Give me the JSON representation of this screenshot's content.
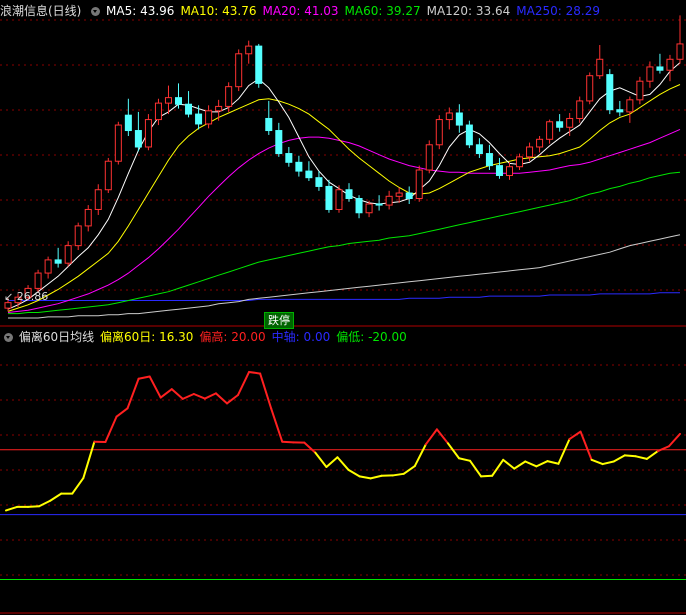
{
  "colors": {
    "bg": "#000000",
    "up": "#ff3232",
    "down": "#54ffff",
    "ma5": "#ffffff",
    "ma10": "#ffff00",
    "ma20": "#ff00ff",
    "ma60": "#00e600",
    "ma120": "#cccccc",
    "ma250": "#2a2aff",
    "grid": "#8a0000"
  },
  "main_panel": {
    "title": "浪潮信息(日线)",
    "indicators": [
      {
        "label": "MA5: 43.96",
        "color": "#ffffff"
      },
      {
        "label": "MA10: 43.76",
        "color": "#ffff00"
      },
      {
        "label": "MA20: 41.03",
        "color": "#ff00ff"
      },
      {
        "label": "MA60: 39.27",
        "color": "#00e600"
      },
      {
        "label": "MA120: 33.64",
        "color": "#cccccc"
      },
      {
        "label": "MA250: 28.29",
        "color": "#2a2aff"
      }
    ],
    "low_label": "26.86",
    "event_tag": "跌停"
  },
  "sub_panel": {
    "title": "偏离60日均线",
    "indicators": [
      {
        "label": "偏离60日: 16.30",
        "color": "#ffff00"
      },
      {
        "label": "偏高: 20.00",
        "color": "#ff2020"
      },
      {
        "label": "中轴: 0.00",
        "color": "#2a2aff"
      },
      {
        "label": "偏低: -20.00",
        "color": "#00e600"
      }
    ]
  },
  "chart_data": [
    {
      "type": "candlestick",
      "title": "浪潮信息(日线)",
      "ylim": [
        26,
        53
      ],
      "candles": [
        [
          26.9,
          27.8,
          26.6,
          27.4
        ],
        [
          27.4,
          28.2,
          27.0,
          27.9
        ],
        [
          27.9,
          29.0,
          27.6,
          28.7
        ],
        [
          28.7,
          30.4,
          28.4,
          30.1
        ],
        [
          30.1,
          31.6,
          29.6,
          31.3
        ],
        [
          31.3,
          32.4,
          30.6,
          31.0
        ],
        [
          31.0,
          33.0,
          30.7,
          32.6
        ],
        [
          32.6,
          34.7,
          32.2,
          34.4
        ],
        [
          34.4,
          36.3,
          33.9,
          35.9
        ],
        [
          35.9,
          38.2,
          35.4,
          37.7
        ],
        [
          37.7,
          40.6,
          37.4,
          40.3
        ],
        [
          40.3,
          43.9,
          40.0,
          43.6
        ],
        [
          44.5,
          46.0,
          42.6,
          43.1
        ],
        [
          43.1,
          44.8,
          41.2,
          41.6
        ],
        [
          41.6,
          44.6,
          41.3,
          44.1
        ],
        [
          44.1,
          46.0,
          43.6,
          45.6
        ],
        [
          45.6,
          47.2,
          44.6,
          46.1
        ],
        [
          46.1,
          47.4,
          45.1,
          45.5
        ],
        [
          45.5,
          46.7,
          44.3,
          44.6
        ],
        [
          44.6,
          45.4,
          43.2,
          43.7
        ],
        [
          43.7,
          45.4,
          43.3,
          44.9
        ],
        [
          44.9,
          45.9,
          44.0,
          45.3
        ],
        [
          45.3,
          47.5,
          44.8,
          47.1
        ],
        [
          47.1,
          50.5,
          46.7,
          50.1
        ],
        [
          50.1,
          51.3,
          49.2,
          50.8
        ],
        [
          50.8,
          51.0,
          47.0,
          47.4
        ],
        [
          44.2,
          45.8,
          42.7,
          43.1
        ],
        [
          43.1,
          43.8,
          40.7,
          41.0
        ],
        [
          41.0,
          41.6,
          39.8,
          40.2
        ],
        [
          40.2,
          40.8,
          38.9,
          39.4
        ],
        [
          39.4,
          40.3,
          38.5,
          38.8
        ],
        [
          38.8,
          39.4,
          37.6,
          38.0
        ],
        [
          38.0,
          38.6,
          35.6,
          35.9
        ],
        [
          35.9,
          38.1,
          35.6,
          37.7
        ],
        [
          37.7,
          38.3,
          36.6,
          36.9
        ],
        [
          36.9,
          37.2,
          35.1,
          35.6
        ],
        [
          35.6,
          36.7,
          35.2,
          36.4
        ],
        [
          36.4,
          37.2,
          35.8,
          36.3
        ],
        [
          36.3,
          37.6,
          35.9,
          37.1
        ],
        [
          37.1,
          37.9,
          36.5,
          37.4
        ],
        [
          37.4,
          38.0,
          36.4,
          36.9
        ],
        [
          36.9,
          39.9,
          36.6,
          39.5
        ],
        [
          39.5,
          42.2,
          39.2,
          41.8
        ],
        [
          41.8,
          44.5,
          41.4,
          44.1
        ],
        [
          44.1,
          45.2,
          43.2,
          44.7
        ],
        [
          44.7,
          45.5,
          42.9,
          43.6
        ],
        [
          43.6,
          44.0,
          41.5,
          41.8
        ],
        [
          41.8,
          42.4,
          40.6,
          41.0
        ],
        [
          41.0,
          41.8,
          39.5,
          39.9
        ],
        [
          39.9,
          40.6,
          38.7,
          39.0
        ],
        [
          39.0,
          40.2,
          38.6,
          39.8
        ],
        [
          39.8,
          41.0,
          39.5,
          40.7
        ],
        [
          40.7,
          42.0,
          40.3,
          41.6
        ],
        [
          41.6,
          42.6,
          41.1,
          42.3
        ],
        [
          42.3,
          44.1,
          41.9,
          43.9
        ],
        [
          43.9,
          44.6,
          43.0,
          43.4
        ],
        [
          43.4,
          44.7,
          42.6,
          44.2
        ],
        [
          44.2,
          46.2,
          43.8,
          45.8
        ],
        [
          45.8,
          48.4,
          45.5,
          48.1
        ],
        [
          48.1,
          50.9,
          47.8,
          49.6
        ],
        [
          48.2,
          48.7,
          44.6,
          45.0
        ],
        [
          45.0,
          45.8,
          44.4,
          44.8
        ],
        [
          44.8,
          46.2,
          43.8,
          45.9
        ],
        [
          45.9,
          48.0,
          45.5,
          47.6
        ],
        [
          47.6,
          49.4,
          47.0,
          48.9
        ],
        [
          48.9,
          50.1,
          48.3,
          48.6
        ],
        [
          48.6,
          50.0,
          47.6,
          49.6
        ],
        [
          49.6,
          53.6,
          49.2,
          51.0
        ]
      ],
      "ma5": [
        26.8,
        27.2,
        27.7,
        28.4,
        29.1,
        29.8,
        30.7,
        31.6,
        32.4,
        33.6,
        35.0,
        37.0,
        39.2,
        41.3,
        43.0,
        44.3,
        44.8,
        45.5,
        45.4,
        45.1,
        44.8,
        44.8,
        45.2,
        46.0,
        47.2,
        47.8,
        47.0,
        45.7,
        44.3,
        42.5,
        40.7,
        39.4,
        38.4,
        37.8,
        37.2,
        36.8,
        36.5,
        36.4,
        36.5,
        36.6,
        36.9,
        37.7,
        38.5,
        39.9,
        41.6,
        42.7,
        43.2,
        42.8,
        42.0,
        41.0,
        40.1,
        40.0,
        40.2,
        40.9,
        41.7,
        42.4,
        43.0,
        43.6,
        44.8,
        46.0,
        46.7,
        47.0,
        46.6,
        46.2,
        46.4,
        47.3,
        48.5,
        49.3
      ],
      "ma10": [
        26.6,
        26.9,
        27.2,
        27.6,
        28.1,
        28.6,
        29.2,
        29.8,
        30.5,
        31.2,
        31.9,
        33.0,
        34.4,
        35.9,
        37.4,
        38.9,
        40.4,
        41.7,
        42.6,
        43.3,
        43.8,
        44.3,
        44.7,
        45.1,
        45.5,
        45.9,
        46.0,
        45.8,
        45.5,
        45.1,
        44.6,
        43.9,
        43.2,
        42.3,
        41.4,
        40.6,
        39.9,
        39.2,
        38.5,
        37.9,
        37.4,
        37.3,
        37.4,
        37.8,
        38.3,
        38.8,
        39.3,
        39.6,
        39.9,
        40.1,
        40.3,
        40.5,
        40.6,
        40.7,
        40.8,
        41.0,
        41.3,
        41.6,
        42.3,
        43.1,
        43.8,
        44.3,
        44.6,
        45.2,
        45.8,
        46.4,
        46.9,
        47.3
      ],
      "ma20": [
        26.5,
        26.6,
        26.7,
        26.9,
        27.1,
        27.3,
        27.6,
        27.9,
        28.2,
        28.6,
        29.0,
        29.5,
        30.1,
        30.8,
        31.5,
        32.3,
        33.2,
        34.1,
        35.1,
        36.1,
        37.1,
        38.0,
        38.9,
        39.7,
        40.4,
        41.0,
        41.5,
        41.9,
        42.2,
        42.4,
        42.5,
        42.5,
        42.4,
        42.2,
        42.0,
        41.7,
        41.3,
        40.9,
        40.5,
        40.2,
        39.9,
        39.7,
        39.5,
        39.4,
        39.3,
        39.3,
        39.2,
        39.2,
        39.2,
        39.2,
        39.2,
        39.2,
        39.3,
        39.4,
        39.5,
        39.7,
        39.9,
        40.0,
        40.2,
        40.5,
        40.8,
        41.1,
        41.4,
        41.7,
        42.0,
        42.4,
        42.8,
        43.2
      ],
      "ma60": [
        26.4,
        26.4,
        26.5,
        26.5,
        26.6,
        26.7,
        26.8,
        26.9,
        27.0,
        27.1,
        27.2,
        27.4,
        27.6,
        27.8,
        28.0,
        28.2,
        28.4,
        28.7,
        29.0,
        29.3,
        29.6,
        29.9,
        30.2,
        30.5,
        30.8,
        31.1,
        31.3,
        31.5,
        31.7,
        31.9,
        32.1,
        32.3,
        32.5,
        32.6,
        32.8,
        32.9,
        33.0,
        33.1,
        33.3,
        33.4,
        33.5,
        33.7,
        33.9,
        34.1,
        34.3,
        34.5,
        34.7,
        34.9,
        35.1,
        35.3,
        35.5,
        35.7,
        35.9,
        36.1,
        36.3,
        36.5,
        36.7,
        37.0,
        37.3,
        37.5,
        37.8,
        38.0,
        38.3,
        38.5,
        38.8,
        39.0,
        39.2,
        39.3
      ],
      "ma120": [
        26.0,
        26.0,
        26.0,
        26.0,
        26.1,
        26.1,
        26.1,
        26.2,
        26.2,
        26.2,
        26.3,
        26.3,
        26.4,
        26.4,
        26.5,
        26.6,
        26.7,
        26.8,
        26.9,
        27.0,
        27.1,
        27.3,
        27.4,
        27.5,
        27.7,
        27.8,
        27.9,
        28.0,
        28.1,
        28.2,
        28.3,
        28.4,
        28.5,
        28.6,
        28.7,
        28.8,
        28.9,
        29.0,
        29.1,
        29.2,
        29.3,
        29.4,
        29.5,
        29.6,
        29.7,
        29.8,
        29.9,
        30.0,
        30.1,
        30.2,
        30.3,
        30.4,
        30.5,
        30.6,
        30.8,
        31.0,
        31.2,
        31.4,
        31.6,
        31.8,
        32.0,
        32.3,
        32.6,
        32.8,
        33.0,
        33.2,
        33.4,
        33.6
      ],
      "ma250": [
        27.6,
        27.6,
        27.6,
        27.6,
        27.6,
        27.6,
        27.6,
        27.6,
        27.6,
        27.6,
        27.6,
        27.6,
        27.6,
        27.6,
        27.6,
        27.6,
        27.6,
        27.6,
        27.6,
        27.6,
        27.6,
        27.6,
        27.6,
        27.6,
        27.6,
        27.7,
        27.7,
        27.7,
        27.7,
        27.7,
        27.7,
        27.7,
        27.7,
        27.7,
        27.7,
        27.7,
        27.7,
        27.7,
        27.7,
        27.7,
        27.8,
        27.8,
        27.8,
        27.8,
        27.9,
        27.9,
        27.9,
        27.9,
        28.0,
        28.0,
        28.0,
        28.0,
        28.0,
        28.0,
        28.1,
        28.1,
        28.1,
        28.1,
        28.1,
        28.2,
        28.2,
        28.2,
        28.2,
        28.2,
        28.2,
        28.3,
        28.3,
        28.3
      ]
    },
    {
      "type": "line",
      "title": "偏离60日均线",
      "ylim": [
        -30,
        52
      ],
      "hlines": [
        {
          "name": "偏高",
          "value": 20
        },
        {
          "name": "中轴",
          "value": 0
        },
        {
          "name": "偏低",
          "value": -20
        }
      ],
      "values": [
        1.3,
        2.4,
        2.4,
        2.6,
        4.3,
        6.5,
        6.5,
        11.3,
        22.5,
        22.4,
        30.2,
        32.8,
        41.9,
        42.6,
        36.1,
        38.7,
        35.7,
        37.2,
        35.8,
        37.4,
        34.3,
        36.9,
        44.0,
        43.5,
        32.7,
        22.5,
        22.3,
        22.2,
        19.1,
        14.7,
        17.7,
        13.8,
        11.8,
        11.2,
        12.0,
        12.1,
        12.6,
        15.0,
        21.7,
        26.3,
        22.0,
        17.4,
        16.6,
        11.8,
        12.0,
        16.9,
        14.2,
        16.4,
        14.9,
        16.5,
        15.7,
        23.3,
        25.6,
        16.9,
        15.6,
        16.4,
        18.3,
        18.0,
        17.2,
        19.6,
        21.1,
        24.9
      ]
    }
  ]
}
